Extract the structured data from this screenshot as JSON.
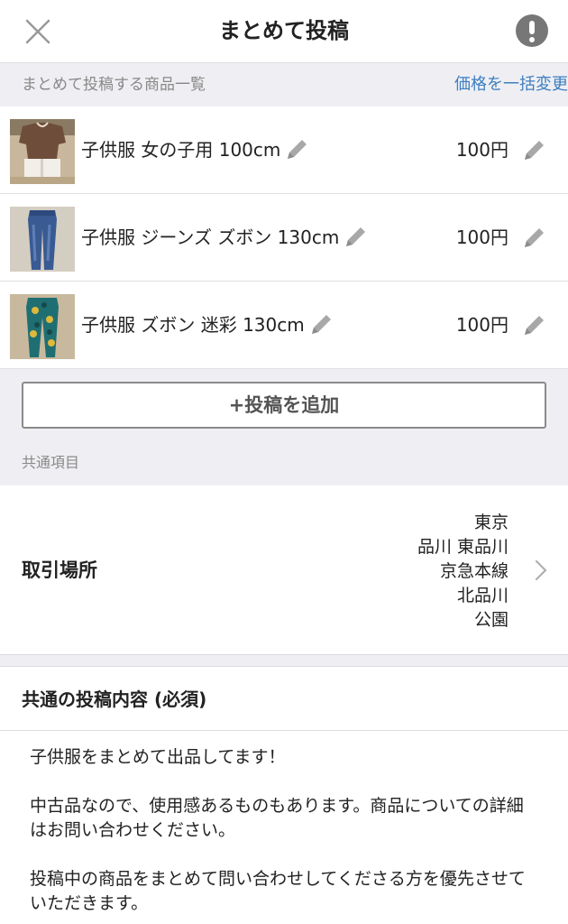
{
  "navbar": {
    "title": "まとめて投稿",
    "close_icon": "close-icon",
    "alert_icon": "exclamation-circle-icon"
  },
  "list_header": {
    "label": "まとめて投稿する商品一覧",
    "bulk_price_link": "価格を一括変更"
  },
  "items": [
    {
      "name": "子供服 女の子用 100cm",
      "price": "100円",
      "thumb": "brown-top-and-shorts"
    },
    {
      "name": "子供服 ジーンズ ズボン 130cm",
      "price": "100円",
      "thumb": "blue-jeans"
    },
    {
      "name": "子供服 ズボン 迷彩 130cm",
      "price": "100円",
      "thumb": "teal-camo-pants"
    }
  ],
  "add_button": {
    "label": "+投稿を追加"
  },
  "common_section": {
    "label": "共通項目"
  },
  "location": {
    "label": "取引場所",
    "lines": [
      "東京",
      "品川 東品川",
      "京急本線",
      "北品川",
      "公園"
    ]
  },
  "description": {
    "header": "共通の投稿内容 (必須)",
    "text": "子供服をまとめて出品してます！\n\n中古品なので、使用感あるものもあります。商品についての詳細はお問い合わせください。\n\n投稿中の商品をまとめて問い合わせしてくださる方を優先させていただきます。"
  },
  "colors": {
    "accent_link": "#3e7fc1",
    "section_bg": "#efeff3",
    "icon_gray": "#a8a8a8"
  }
}
